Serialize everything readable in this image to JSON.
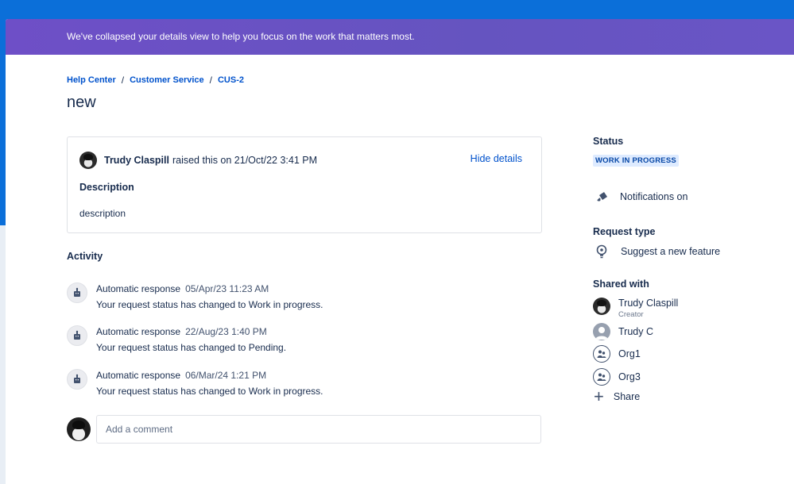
{
  "banner": {
    "message": "We've collapsed your details view to help you focus on the work that matters most."
  },
  "breadcrumb": {
    "items": [
      "Help Center",
      "Customer Service",
      "CUS-2"
    ],
    "separator": "/"
  },
  "request": {
    "title": "new",
    "raised_by": "Trudy Claspill",
    "raised_text": "raised this on 21/Oct/22 3:41 PM",
    "hide_details_label": "Hide details",
    "description_label": "Description",
    "description_text": "description"
  },
  "activity": {
    "title": "Activity",
    "items": [
      {
        "author": "Automatic response",
        "time": "05/Apr/23 11:23 AM",
        "message": "Your request status has changed to Work in progress."
      },
      {
        "author": "Automatic response",
        "time": "22/Aug/23 1:40 PM",
        "message": "Your request status has changed to Pending."
      },
      {
        "author": "Automatic response",
        "time": "06/Mar/24 1:21 PM",
        "message": "Your request status has changed to Work in progress."
      }
    ]
  },
  "comment": {
    "placeholder": "Add a comment"
  },
  "sidebar": {
    "status_label": "Status",
    "status_value": "WORK IN PROGRESS",
    "notifications_label": "Notifications on",
    "request_type_label": "Request type",
    "request_type_value": "Suggest a new feature",
    "shared_with_label": "Shared with",
    "shared": [
      {
        "name": "Trudy Claspill",
        "role": "Creator",
        "kind": "photo"
      },
      {
        "name": "Trudy C",
        "role": "",
        "kind": "person"
      },
      {
        "name": "Org1",
        "role": "",
        "kind": "org"
      },
      {
        "name": "Org3",
        "role": "",
        "kind": "org"
      }
    ],
    "share_label": "Share"
  },
  "colors": {
    "banner": "#6554c0",
    "link": "#0052cc",
    "lozenge_bg": "#deebff",
    "lozenge_text": "#0747a6",
    "page_bg": "#0b6fd9"
  }
}
